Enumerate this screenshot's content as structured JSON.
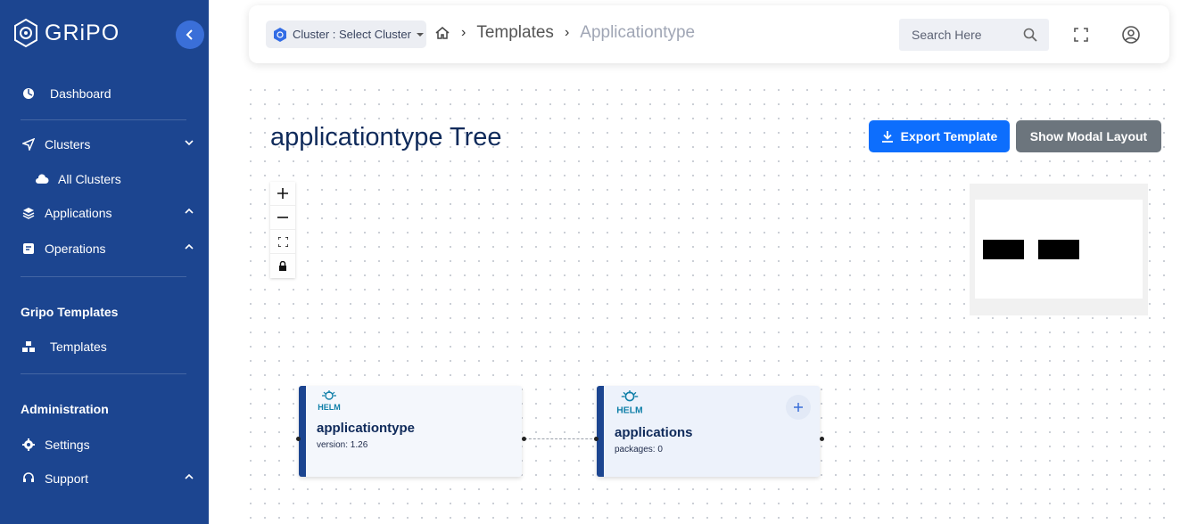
{
  "brand": {
    "name": "GRiPO"
  },
  "sidebar": {
    "dashboard": "Dashboard",
    "clusters": "Clusters",
    "all_clusters": "All Clusters",
    "applications": "Applications",
    "operations": "Operations",
    "section_templates": "Gripo Templates",
    "templates": "Templates",
    "section_admin": "Administration",
    "settings": "Settings",
    "support": "Support"
  },
  "topbar": {
    "cluster_select": "Cluster : Select Cluster",
    "breadcrumb": [
      "Templates",
      "Applicationtype"
    ],
    "search_placeholder": "Search Here"
  },
  "page": {
    "title": "applicationtype Tree",
    "export_button": "Export Template",
    "modal_button": "Show Modal Layout"
  },
  "nodes": [
    {
      "badge": "HELM",
      "title": "applicationtype",
      "subtitle": "version: 1.26"
    },
    {
      "badge": "HELM",
      "title": "applications",
      "subtitle": "packages: 0"
    }
  ],
  "colors": {
    "sidebar": "#1c4590",
    "primary": "#0d6efd",
    "secondary": "#6c757d"
  }
}
